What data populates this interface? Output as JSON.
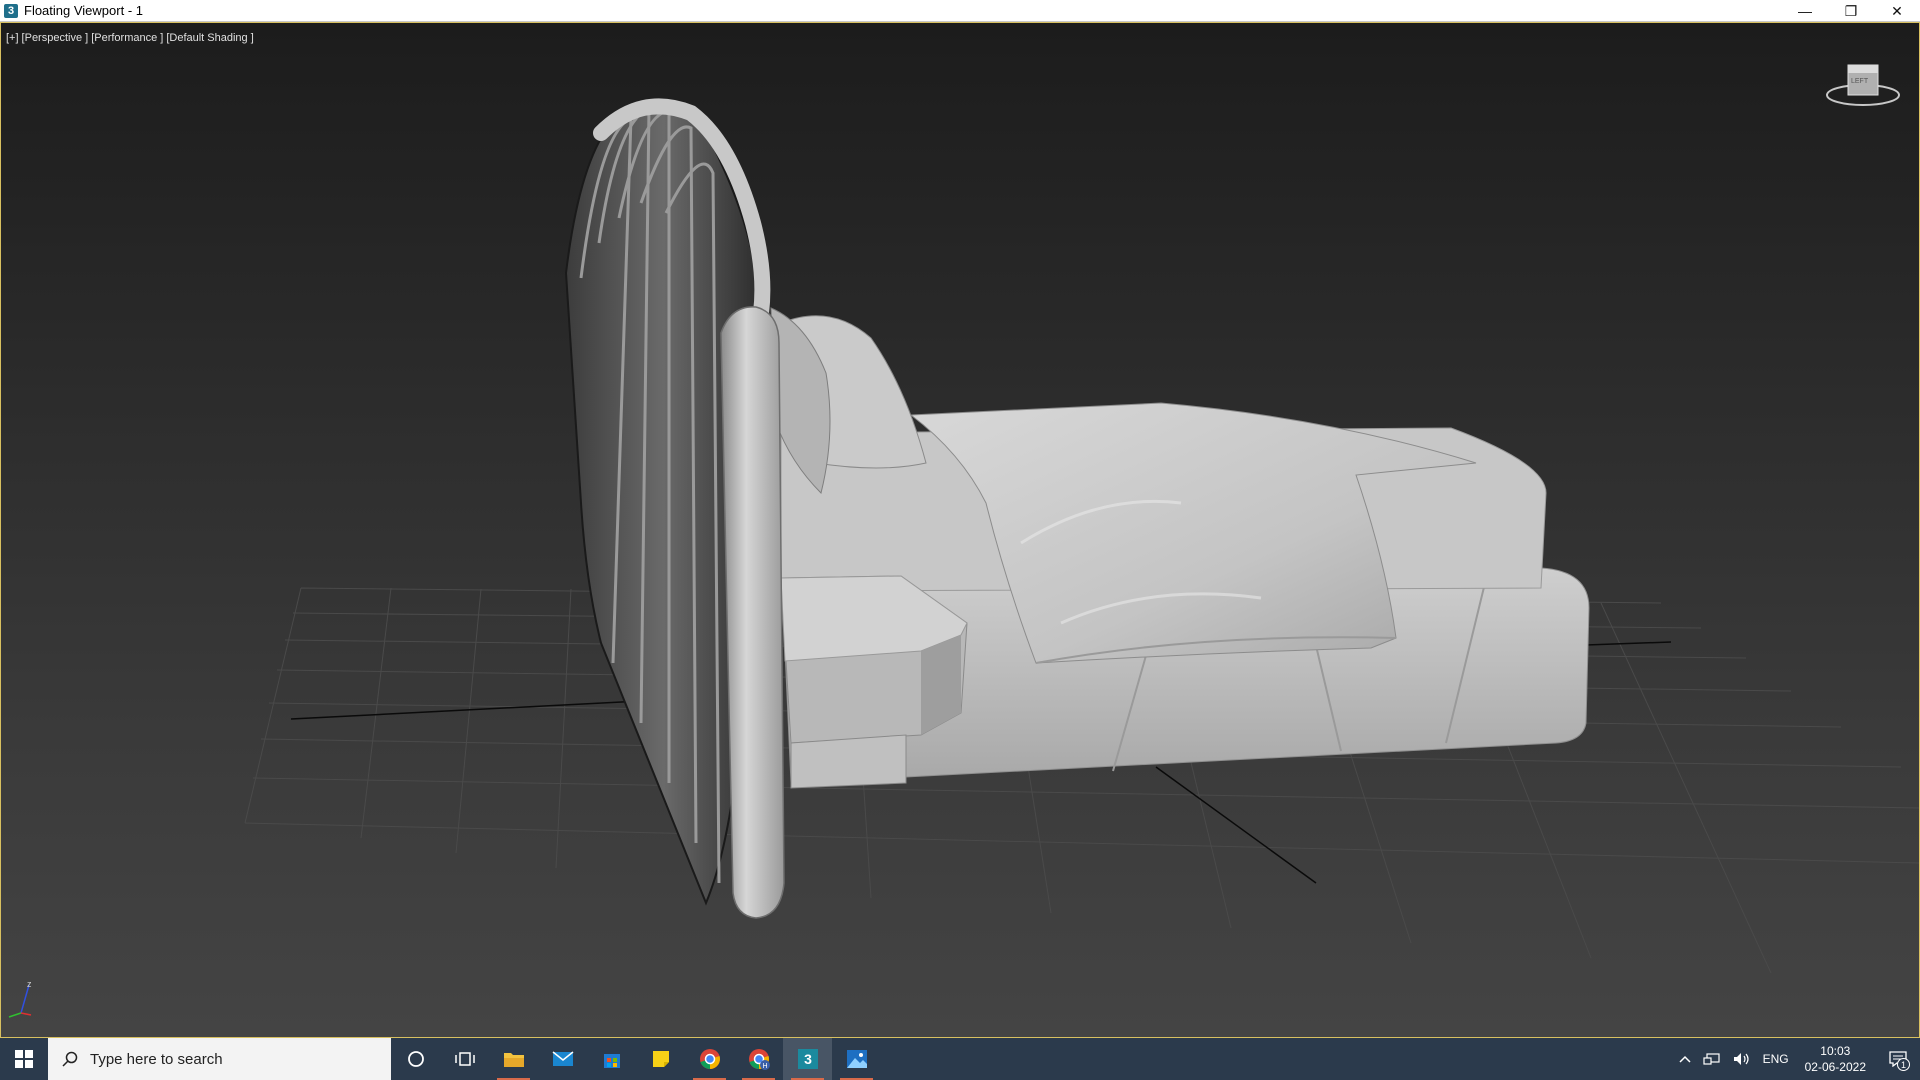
{
  "window": {
    "title": "Floating Viewport - 1",
    "app_icon_glyph": "3",
    "minimize_glyph": "—",
    "restore_glyph": "❐",
    "close_glyph": "✕"
  },
  "viewport": {
    "label_plus": "[+]",
    "label_view": "[Perspective ]",
    "label_mode": "[Performance ]",
    "label_shading": "[Default Shading ]",
    "axis_z": "z",
    "viewcube_text": "LEFT",
    "background_top": "#1c1c1c",
    "background_bottom": "#444444",
    "model_color": "#b9b9b9"
  },
  "taskbar": {
    "search_placeholder": "Type here to search",
    "apps": [
      {
        "name": "cortana-icon",
        "running": false
      },
      {
        "name": "task-view-icon",
        "running": false
      },
      {
        "name": "file-explorer-icon",
        "running": true
      },
      {
        "name": "mail-icon",
        "running": false
      },
      {
        "name": "store-icon",
        "running": false
      },
      {
        "name": "sticky-notes-icon",
        "running": false
      },
      {
        "name": "chrome-icon",
        "running": true
      },
      {
        "name": "chrome-profile-icon",
        "running": true
      },
      {
        "name": "3ds-max-icon",
        "running": true,
        "active": true
      },
      {
        "name": "photos-icon",
        "running": true
      }
    ],
    "chrome_badge": "H",
    "max_glyph": "3",
    "tray": {
      "chevron": "^",
      "language": "ENG",
      "time": "10:03",
      "date": "02-06-2022",
      "notification_count": "1"
    },
    "accent": "#d86a4a",
    "bar_color": "#2b3a4c"
  }
}
